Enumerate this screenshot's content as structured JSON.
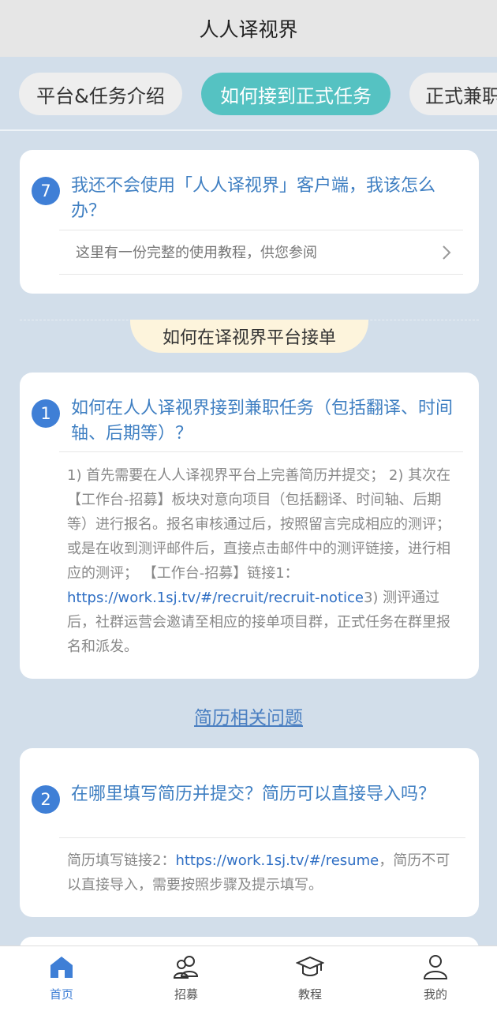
{
  "header": {
    "title": "人人译视界"
  },
  "tabs": [
    {
      "label": "平台&任务介绍",
      "active": false
    },
    {
      "label": "如何接到正式任务",
      "active": true
    },
    {
      "label": "正式兼职",
      "active": false
    }
  ],
  "cards": {
    "q7": {
      "number": "7",
      "title": "我还不会使用「人人译视界」客户端，我该怎么办？",
      "link_text": "这里有一份完整的使用教程，供您参阅"
    },
    "section_title": "如何在译视界平台接单",
    "q1": {
      "number": "1",
      "title": "如何在人人译视界接到兼职任务（包括翻译、时间轴、后期等）？",
      "answer_part1": "1) 首先需要在人人译视界平台上完善简历并提交； 2) 其次在【工作台-招募】板块对意向项目（包括翻译、时间轴、后期等）进行报名。报名审核通过后，按照留言完成相应的测评；或是在收到测评邮件后，直接点击邮件中的测评链接，进行相应的测评； 【工作台-招募】链接1：",
      "answer_link": "https://work.1sj.tv/#/recruit/recruit-notice",
      "answer_part2": "3) 测评通过后，社群运营会邀请至相应的接单项目群，正式任务在群里报名和派发。"
    },
    "resume_section": "简历相关问题",
    "q2": {
      "number": "2",
      "title": "在哪里填写简历并提交？简历可以直接导入吗？",
      "answer_part1": "简历填写链接2：",
      "answer_link": "https://work.1sj.tv/#/resume",
      "answer_part2": "，简历不可以直接导入，需要按照步骤及提示填写。"
    }
  },
  "bottom_nav": [
    {
      "label": "首页",
      "icon": "home-icon",
      "active": true
    },
    {
      "label": "招募",
      "icon": "users-icon",
      "active": false
    },
    {
      "label": "教程",
      "icon": "graduation-cap-icon",
      "active": false
    },
    {
      "label": "我的",
      "icon": "user-icon",
      "active": false
    }
  ],
  "colors": {
    "accent": "#3f7fd6",
    "active_tab": "#55c2c2",
    "background": "#d2deea"
  }
}
